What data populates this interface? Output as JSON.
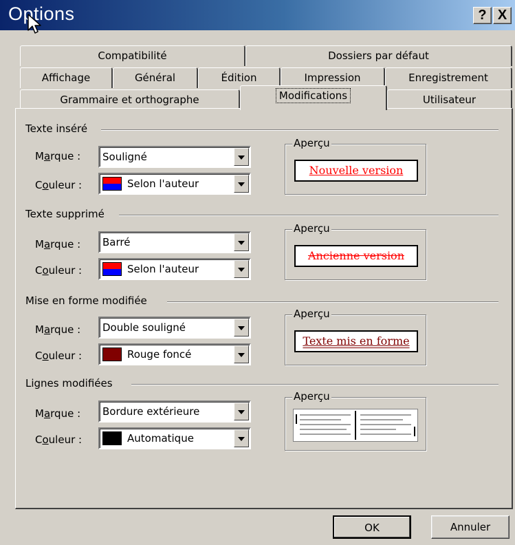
{
  "window": {
    "title": "Options",
    "help_glyph": "?",
    "close_glyph": "X"
  },
  "tabs": {
    "row1": [
      "Compatibilité",
      "Dossiers par défaut"
    ],
    "row2": [
      "Affichage",
      "Général",
      "Édition",
      "Impression",
      "Enregistrement"
    ],
    "row3": [
      "Grammaire et orthographe",
      "Modifications",
      "Utilisateur"
    ],
    "active": "Modifications"
  },
  "labels": {
    "mark_pre": "M",
    "mark_u": "a",
    "mark_post": "rque :",
    "color_pre": "C",
    "color_u": "o",
    "color_post": "uleur :",
    "preview": "Aperçu"
  },
  "groups": {
    "inserted": {
      "title": "Texte inséré",
      "mark": "Souligné",
      "color": "Selon l'auteur",
      "preview": "Nouvelle version"
    },
    "deleted": {
      "title": "Texte supprimé",
      "mark": "Barré",
      "color": "Selon l'auteur",
      "preview": "Ancienne version"
    },
    "formatted": {
      "title": "Mise en forme modifiée",
      "mark": "Double souligné",
      "color": "Rouge foncé",
      "preview": "Texte mis en forme"
    },
    "lines": {
      "title": "Lignes modifiées",
      "mark": "Bordure extérieure",
      "color": "Automatique"
    }
  },
  "colors": {
    "author_top": "#ff0000",
    "author_bottom": "#0000ff",
    "dark_red": "#800000",
    "auto": "#000000",
    "preview_red": "#ff0000",
    "preview_darkred": "#800000"
  },
  "buttons": {
    "ok": "OK",
    "cancel": "Annuler"
  }
}
